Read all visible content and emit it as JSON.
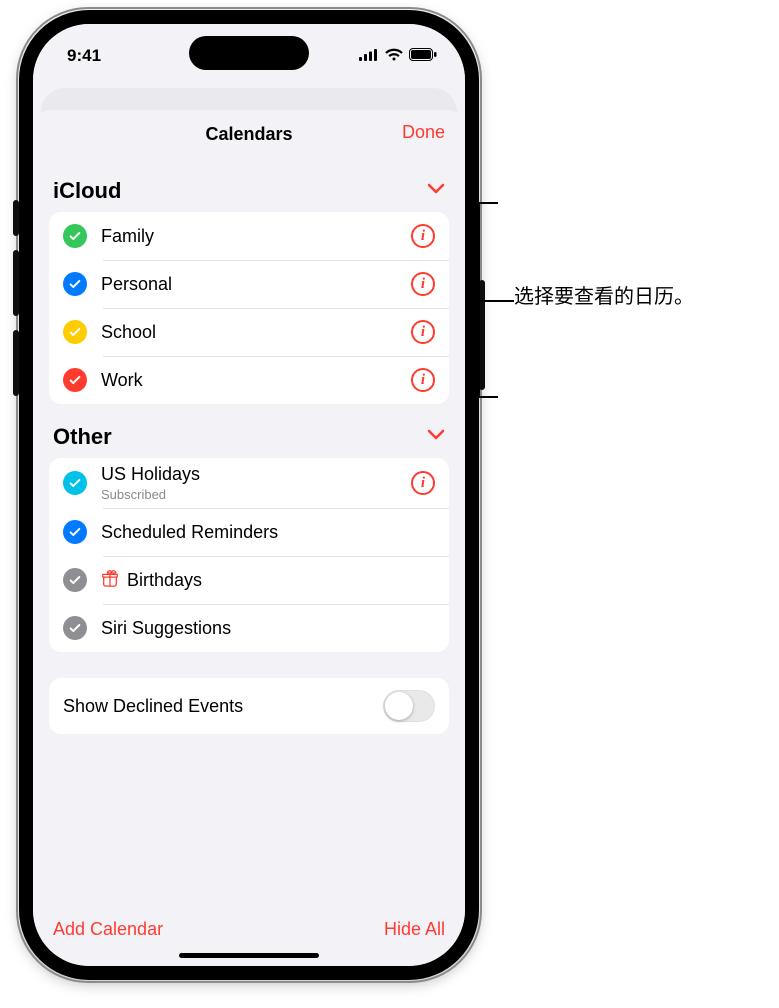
{
  "status": {
    "time": "9:41"
  },
  "sheet": {
    "title": "Calendars",
    "done": "Done"
  },
  "sections": {
    "icloud": {
      "title": "iCloud",
      "items": [
        {
          "label": "Family",
          "color": "#34c759"
        },
        {
          "label": "Personal",
          "color": "#007aff"
        },
        {
          "label": "School",
          "color": "#ffcc00"
        },
        {
          "label": "Work",
          "color": "#ff3b30"
        }
      ]
    },
    "other": {
      "title": "Other",
      "items": [
        {
          "label": "US Holidays",
          "sub": "Subscribed",
          "color": "#00c2e8",
          "info": true
        },
        {
          "label": "Scheduled Reminders",
          "color": "#007aff",
          "info": false
        },
        {
          "label": "Birthdays",
          "color": "#8e8e93",
          "icon": "gift",
          "info": false
        },
        {
          "label": "Siri Suggestions",
          "color": "#8e8e93",
          "info": false
        }
      ]
    }
  },
  "toggle": {
    "label": "Show Declined Events",
    "on": false
  },
  "footer": {
    "add": "Add Calendar",
    "hide": "Hide All"
  },
  "callout": {
    "text": "选择要查看的日历。"
  },
  "colors": {
    "accent": "#ff3b30"
  }
}
